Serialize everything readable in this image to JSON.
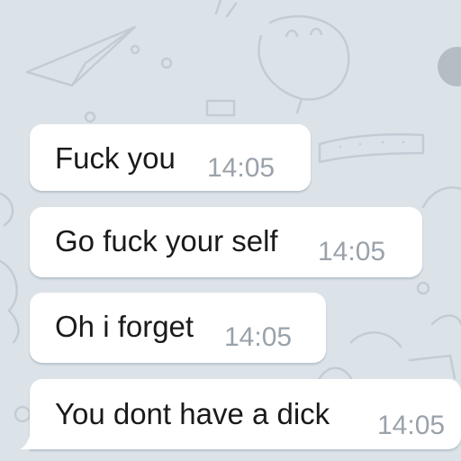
{
  "chat": {
    "background_color": "#dce3e8",
    "bubble_color": "#ffffff",
    "messages": [
      {
        "text": "Fuck you",
        "time": "14:05"
      },
      {
        "text": "Go fuck your self",
        "time": "14:05"
      },
      {
        "text": "Oh i forget",
        "time": "14:05"
      },
      {
        "text": "You dont have a dick",
        "time": "14:05"
      }
    ]
  }
}
